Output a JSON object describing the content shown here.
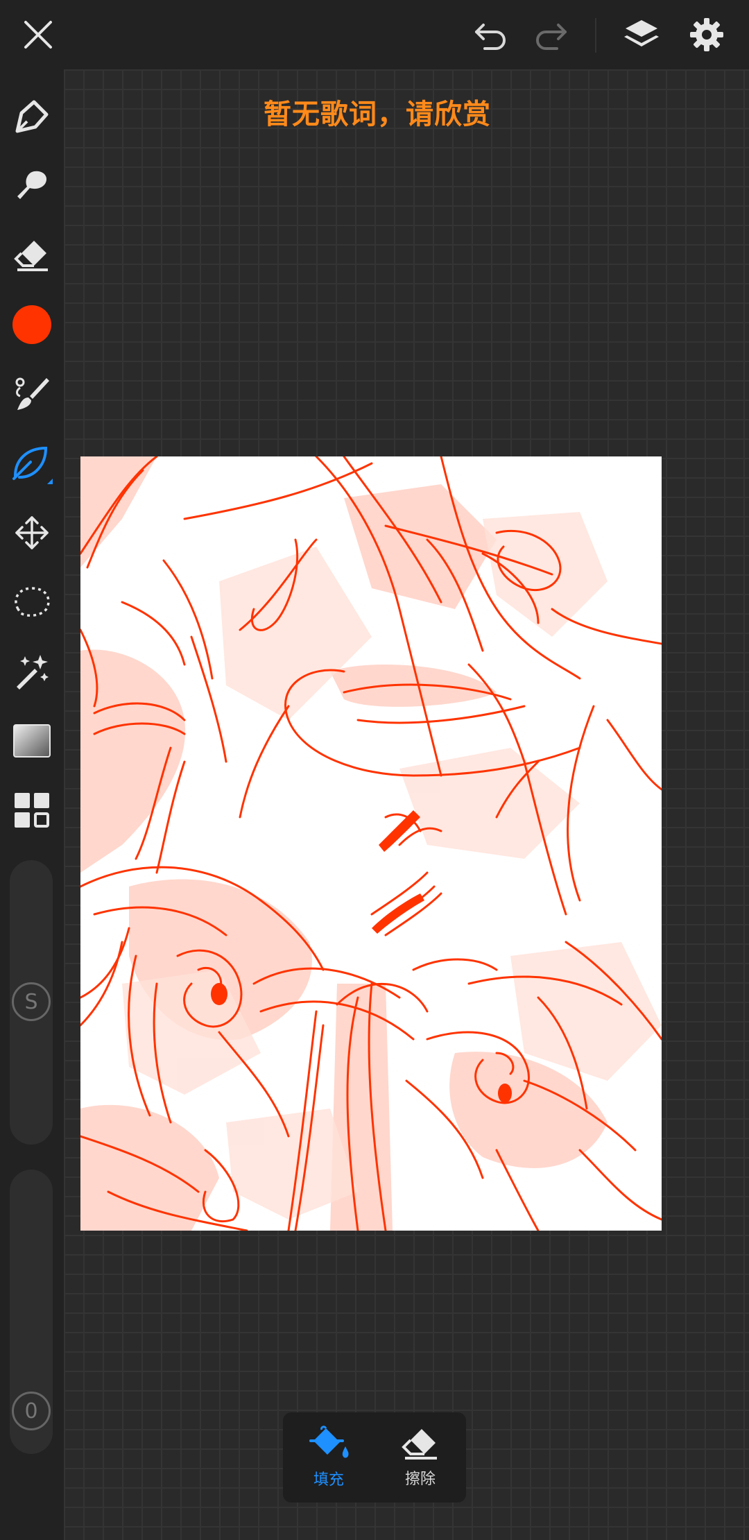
{
  "lyrics": "暂无歌词，请欣赏",
  "colors": {
    "accent": "#1e90ff",
    "brush_color": "#ff3300",
    "lyrics_color": "#ff8a1a"
  },
  "top_bar": {
    "close_icon": "close-icon",
    "undo_icon": "undo-icon",
    "redo_icon": "redo-icon",
    "layers_icon": "layers-icon",
    "settings_icon": "gear-icon"
  },
  "tools": [
    {
      "name": "pen",
      "icon": "pen-nib-icon"
    },
    {
      "name": "smudge",
      "icon": "smudge-icon"
    },
    {
      "name": "eraser",
      "icon": "eraser-icon"
    },
    {
      "name": "color",
      "icon": "color-swatch-icon"
    },
    {
      "name": "brush",
      "icon": "brush-icon"
    },
    {
      "name": "leaf-brush",
      "icon": "leaf-icon",
      "active": true
    },
    {
      "name": "transform",
      "icon": "move-arrows-icon"
    },
    {
      "name": "lasso",
      "icon": "lasso-icon"
    },
    {
      "name": "magic-wand",
      "icon": "magic-wand-icon"
    },
    {
      "name": "gradient",
      "icon": "gradient-icon"
    },
    {
      "name": "grid",
      "icon": "grid-icon"
    }
  ],
  "size_slider": {
    "label": "S"
  },
  "opacity_slider": {
    "label": "0"
  },
  "palette": {
    "fill_label": "填充",
    "erase_label": "擦除"
  }
}
